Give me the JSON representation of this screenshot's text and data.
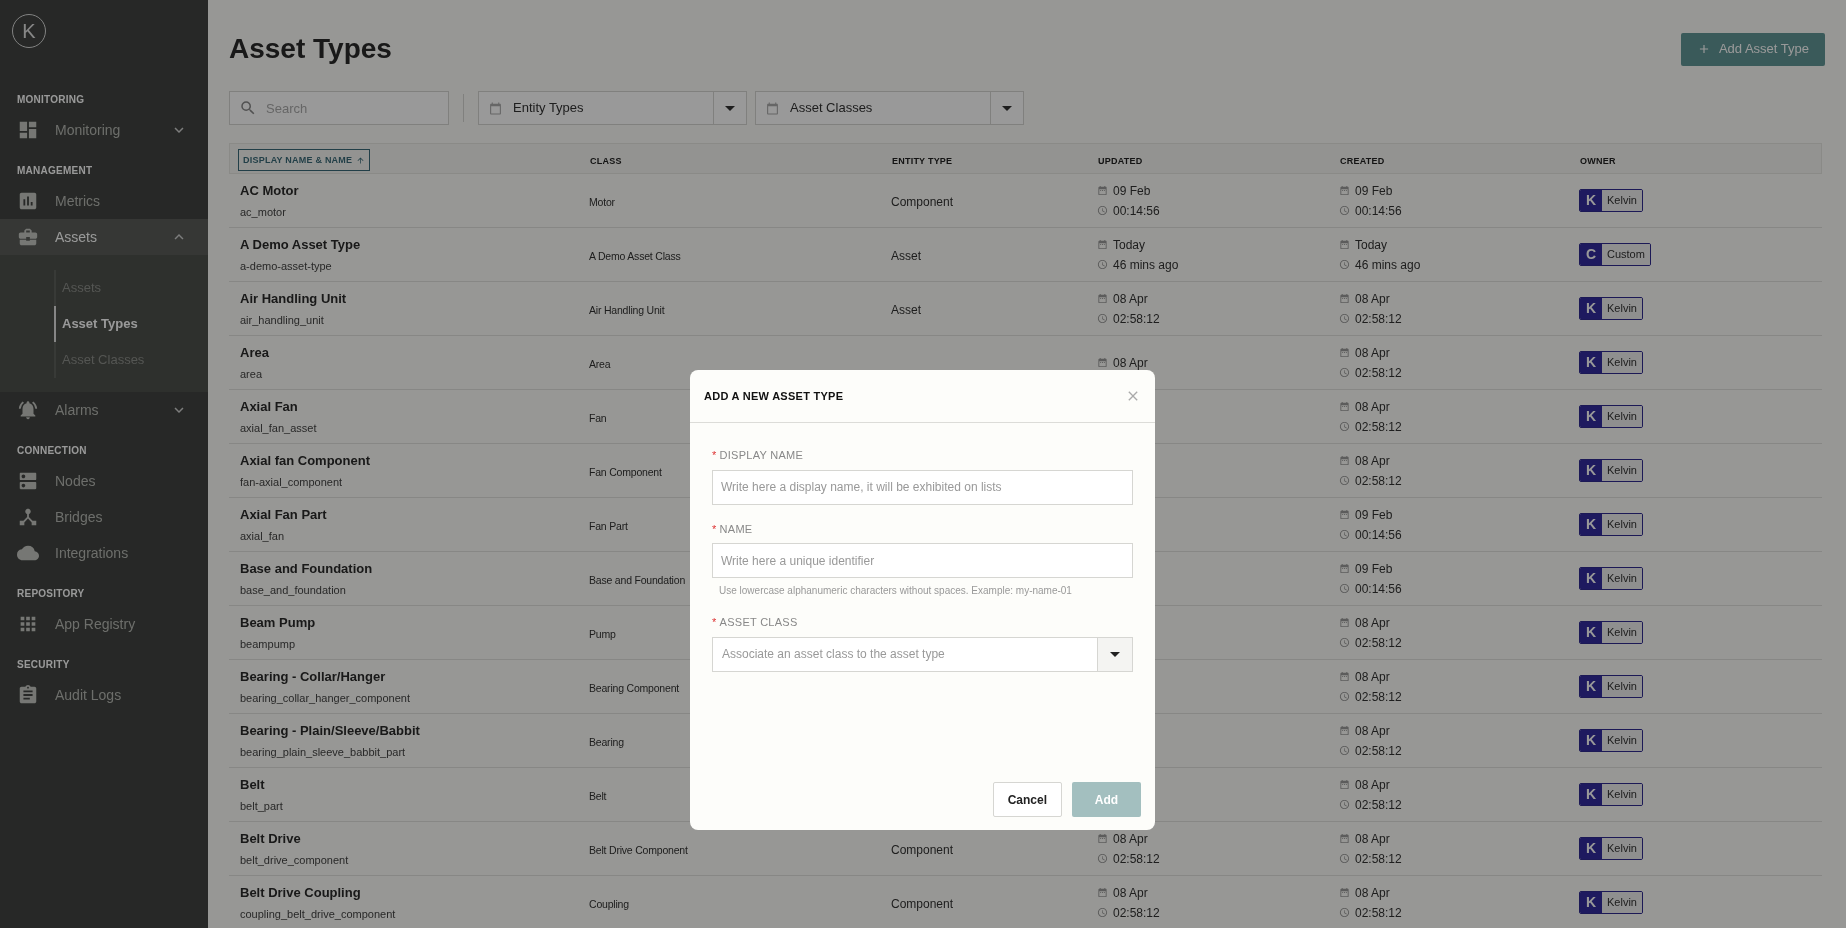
{
  "sidebar": {
    "logo_letter": "K",
    "sections": [
      {
        "heading": "MONITORING",
        "items": [
          {
            "label": "Monitoring",
            "selected": false,
            "expanded": false
          }
        ]
      },
      {
        "heading": "MANAGEMENT",
        "items": [
          {
            "label": "Metrics",
            "selected": false
          },
          {
            "label": "Assets",
            "selected": true,
            "expanded": true,
            "children": [
              {
                "label": "Assets",
                "selected": false
              },
              {
                "label": "Asset Types",
                "selected": true
              },
              {
                "label": "Asset Classes",
                "selected": false
              }
            ]
          },
          {
            "label": "Alarms",
            "selected": false,
            "expanded": false
          }
        ]
      },
      {
        "heading": "CONNECTION",
        "items": [
          {
            "label": "Nodes",
            "selected": false
          },
          {
            "label": "Bridges",
            "selected": false
          },
          {
            "label": "Integrations",
            "selected": false
          }
        ]
      },
      {
        "heading": "REPOSITORY",
        "items": [
          {
            "label": "App Registry",
            "selected": false
          }
        ]
      },
      {
        "heading": "SECURITY",
        "items": [
          {
            "label": "Audit Logs",
            "selected": false
          }
        ]
      }
    ]
  },
  "page": {
    "title": "Asset Types",
    "add_button": "Add Asset Type"
  },
  "filters": {
    "search": {
      "placeholder": "Search"
    },
    "selects": [
      "Entity Types",
      "Asset Classes"
    ]
  },
  "table": {
    "columns": [
      {
        "label": "DISPLAY NAME & NAME",
        "sorted": true
      },
      {
        "label": "CLASS",
        "sorted": false
      },
      {
        "label": "ENTITY TYPE",
        "sorted": false
      },
      {
        "label": "UPDATED",
        "sorted": false
      },
      {
        "label": "CREATED",
        "sorted": false
      },
      {
        "label": "OWNER",
        "sorted": false
      }
    ],
    "rows": [
      {
        "name": "AC Motor",
        "id": "ac_motor",
        "class": "Motor",
        "entity_type": "Component",
        "updated": {
          "date": "09 Feb",
          "time": "00:14:56"
        },
        "created": {
          "date": "09 Feb",
          "time": "00:14:56"
        },
        "owner": {
          "initial": "K",
          "label": "Kelvin"
        }
      },
      {
        "name": "A Demo Asset Type",
        "id": "a-demo-asset-type",
        "class": "A Demo Asset Class",
        "entity_type": "Asset",
        "updated": {
          "date": "Today",
          "time": "46 mins ago"
        },
        "created": {
          "date": "Today",
          "time": "46 mins ago"
        },
        "owner": {
          "initial": "C",
          "label": "Custom"
        }
      },
      {
        "name": "Air Handling Unit",
        "id": "air_handling_unit",
        "class": "Air Handling Unit",
        "entity_type": "Asset",
        "updated": {
          "date": "08 Apr",
          "time": "02:58:12"
        },
        "created": {
          "date": "08 Apr",
          "time": "02:58:12"
        },
        "owner": {
          "initial": "K",
          "label": "Kelvin"
        }
      },
      {
        "name": "Area",
        "id": "area",
        "class": "Area",
        "updated": {
          "date": "08 Apr"
        },
        "created": {
          "date": "08 Apr",
          "time": "02:58:12"
        },
        "owner": {
          "initial": "K",
          "label": "Kelvin"
        }
      },
      {
        "name": "Axial Fan",
        "id": "axial_fan_asset",
        "class": "Fan",
        "created": {
          "date": "08 Apr",
          "time": "02:58:12"
        },
        "owner": {
          "initial": "K",
          "label": "Kelvin"
        }
      },
      {
        "name": "Axial fan Component",
        "id": "fan-axial_component",
        "class": "Fan Component",
        "created": {
          "date": "08 Apr",
          "time": "02:58:12"
        },
        "owner": {
          "initial": "K",
          "label": "Kelvin"
        }
      },
      {
        "name": "Axial Fan Part",
        "id": "axial_fan",
        "class": "Fan Part",
        "created": {
          "date": "09 Feb",
          "time": "00:14:56"
        },
        "owner": {
          "initial": "K",
          "label": "Kelvin"
        }
      },
      {
        "name": "Base and Foundation",
        "id": "base_and_foundation",
        "class": "Base and Foundation",
        "created": {
          "date": "09 Feb",
          "time": "00:14:56"
        },
        "owner": {
          "initial": "K",
          "label": "Kelvin"
        }
      },
      {
        "name": "Beam Pump",
        "id": "beampump",
        "class": "Pump",
        "created": {
          "date": "08 Apr",
          "time": "02:58:12"
        },
        "owner": {
          "initial": "K",
          "label": "Kelvin"
        }
      },
      {
        "name": "Bearing - Collar/Hanger",
        "id": "bearing_collar_hanger_component",
        "class": "Bearing Component",
        "created": {
          "date": "08 Apr",
          "time": "02:58:12"
        },
        "owner": {
          "initial": "K",
          "label": "Kelvin"
        }
      },
      {
        "name": "Bearing - Plain/Sleeve/Babbit",
        "id": "bearing_plain_sleeve_babbit_part",
        "class": "Bearing",
        "created": {
          "date": "08 Apr",
          "time": "02:58:12"
        },
        "owner": {
          "initial": "K",
          "label": "Kelvin"
        }
      },
      {
        "name": "Belt",
        "id": "belt_part",
        "class": "Belt",
        "created": {
          "date": "08 Apr",
          "time": "02:58:12"
        },
        "owner": {
          "initial": "K",
          "label": "Kelvin"
        }
      },
      {
        "name": "Belt Drive",
        "id": "belt_drive_component",
        "class": "Belt Drive Component",
        "entity_type": "Component",
        "updated": {
          "date": "08 Apr",
          "time": "02:58:12"
        },
        "created": {
          "date": "08 Apr",
          "time": "02:58:12"
        },
        "owner": {
          "initial": "K",
          "label": "Kelvin"
        }
      },
      {
        "name": "Belt Drive Coupling",
        "id": "coupling_belt_drive_component",
        "class": "Coupling",
        "entity_type": "Component",
        "updated": {
          "date": "08 Apr",
          "time": "02:58:12"
        },
        "created": {
          "date": "08 Apr",
          "time": "02:58:12"
        },
        "owner": {
          "initial": "K",
          "label": "Kelvin"
        }
      }
    ]
  },
  "dialog": {
    "title": "ADD A NEW ASSET TYPE",
    "fields": [
      {
        "kind": "text",
        "label": "DISPLAY NAME",
        "required": true,
        "placeholder": "Write here a display name, it will be exhibited on lists"
      },
      {
        "kind": "text",
        "label": "NAME",
        "required": true,
        "placeholder": "Write here a unique identifier",
        "hint": "Use lowercase alphanumeric characters without spaces. Example: my-name-01"
      },
      {
        "kind": "select",
        "label": "ASSET CLASS",
        "required": true,
        "placeholder": "Associate an asset class to the asset type"
      }
    ],
    "required_mark": "*",
    "buttons": [
      {
        "label": "Cancel",
        "kind": "secondary",
        "disabled": false
      },
      {
        "label": "Add",
        "kind": "primary",
        "disabled": true
      }
    ]
  }
}
